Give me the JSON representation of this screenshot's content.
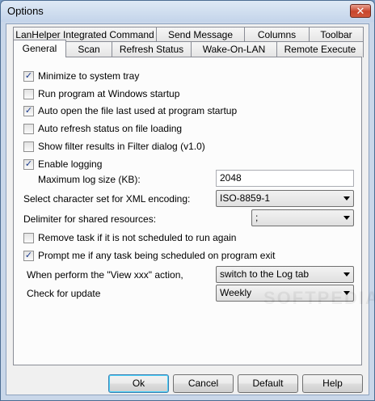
{
  "window": {
    "title": "Options",
    "close_symbol": "✕"
  },
  "tabs_back": [
    "LanHelper Integrated Command",
    "Send Message",
    "Columns",
    "Toolbar"
  ],
  "tabs_front": [
    "General",
    "Scan",
    "Refresh Status",
    "Wake-On-LAN",
    "Remote Execute"
  ],
  "options": {
    "minimize_tray": {
      "label": "Minimize to system tray",
      "checked": true
    },
    "run_startup": {
      "label": "Run program at Windows startup",
      "checked": false
    },
    "auto_open": {
      "label": "Auto open the file last used at program startup",
      "checked": true
    },
    "auto_refresh": {
      "label": "Auto refresh status on file loading",
      "checked": false
    },
    "show_filter": {
      "label": "Show filter results in Filter dialog (v1.0)",
      "checked": false
    },
    "enable_logging": {
      "label": "Enable logging",
      "checked": true
    },
    "max_log_label": "Maximum log size (KB):",
    "max_log_value": "2048",
    "charset_label": "Select character set for XML encoding:",
    "charset_value": "ISO-8859-1",
    "delimiter_label": "Delimiter for shared resources:",
    "delimiter_value": ";",
    "remove_task": {
      "label": "Remove task if it is not scheduled to run again",
      "checked": false
    },
    "prompt_exit": {
      "label": "Prompt me if any task being scheduled on program exit",
      "checked": true
    },
    "view_action_label": "When perform the \"View xxx\" action,",
    "view_action_value": "switch to the Log tab",
    "update_label": "Check for update",
    "update_value": "Weekly"
  },
  "buttons": {
    "ok": "Ok",
    "cancel": "Cancel",
    "default": "Default",
    "help": "Help"
  },
  "watermark": "SOFTPEDIA"
}
